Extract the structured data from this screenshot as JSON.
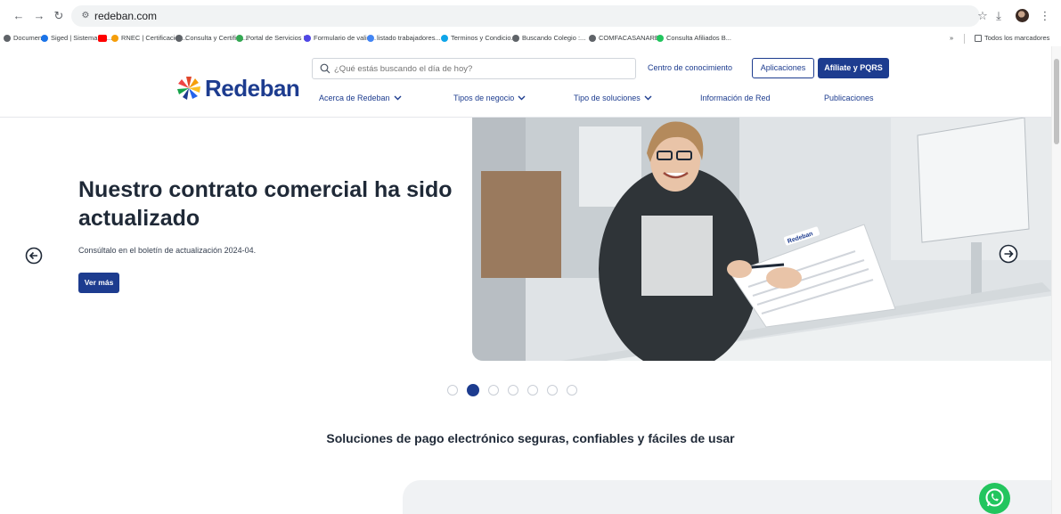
{
  "browser": {
    "url": "redeban.com",
    "bookmarks": [
      {
        "label": "Document",
        "icon": "globe-icon"
      },
      {
        "label": "Siged | Sistema de...",
        "icon": "check-icon"
      },
      {
        "label": "",
        "icon": "youtube-icon"
      },
      {
        "label": "RNEC | Certificación...",
        "icon": "flag-icon"
      },
      {
        "label": "Consulta y Certifica...",
        "icon": "globe-icon"
      },
      {
        "label": "Portal de Servicios I...",
        "icon": "portal-icon"
      },
      {
        "label": "Formulario de valid...",
        "icon": "diamond-icon"
      },
      {
        "label": "listado trabajadores...",
        "icon": "google-icon"
      },
      {
        "label": "Terminos y Condicio...",
        "icon": "leaf-icon"
      },
      {
        "label": "Buscando Colegio :...",
        "icon": "globe-icon"
      },
      {
        "label": "COMFACASANARE",
        "icon": "globe-icon"
      },
      {
        "label": "Consulta Afiliados B...",
        "icon": "shield-icon"
      }
    ],
    "bookmarks_overflow": "»",
    "all_bookmarks": "Todos los marcadores"
  },
  "header": {
    "logo": "Redeban",
    "search_placeholder": "¿Qué estás buscando el día de hoy?",
    "knowledge_link": "Centro de conocimiento",
    "apps_button": "Aplicaciones",
    "join_button": "Afíliate y PQRS",
    "nav": [
      {
        "label": "Acerca de Redeban",
        "dropdown": true
      },
      {
        "label": "Tipos de negocio",
        "dropdown": true
      },
      {
        "label": "Tipo de soluciones",
        "dropdown": true
      },
      {
        "label": "Información de Red",
        "dropdown": false
      },
      {
        "label": "Publicaciones",
        "dropdown": false
      }
    ]
  },
  "hero": {
    "title": "Nuestro contrato comercial ha sido actualizado",
    "subtitle": "Consúltalo en el boletín de actualización 2024-04.",
    "button": "Ver más",
    "image_alt": "woman-holding-contract-photo",
    "document_logo": "Redeban",
    "slide_count": 7,
    "active_slide": 2
  },
  "section": {
    "title": "Soluciones de pago electrónico seguras, confiables y fáciles de usar"
  },
  "colors": {
    "brand_blue": "#1d3c8f",
    "whatsapp_green": "#22c55e"
  }
}
